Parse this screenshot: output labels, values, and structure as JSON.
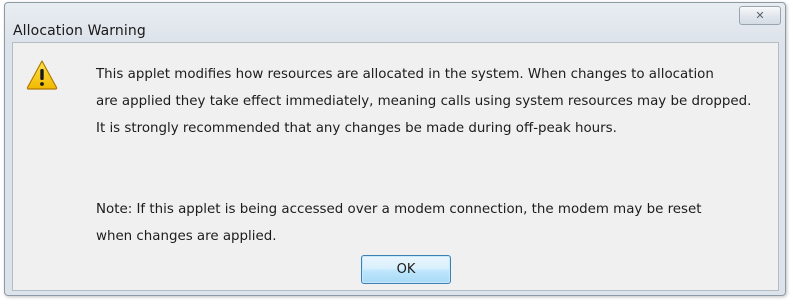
{
  "dialog": {
    "title": "Allocation Warning",
    "close_symbol": "☒",
    "icon": "warning-icon",
    "message_lines": [
      "This applet modifies how resources are allocated in the system.  When changes to allocation",
      "are applied they take effect immediately, meaning calls using system resources may be dropped.",
      "It is strongly recommended that any changes be made during off-peak hours."
    ],
    "note_lines": [
      "Note: If this applet is being accessed over a modem connection, the modem may be reset",
      "when changes are applied."
    ],
    "ok_label": "OK"
  },
  "colors": {
    "warning_yellow": "#f5c400",
    "warning_outline": "#b07a00",
    "ok_border": "#3c7fb1"
  }
}
